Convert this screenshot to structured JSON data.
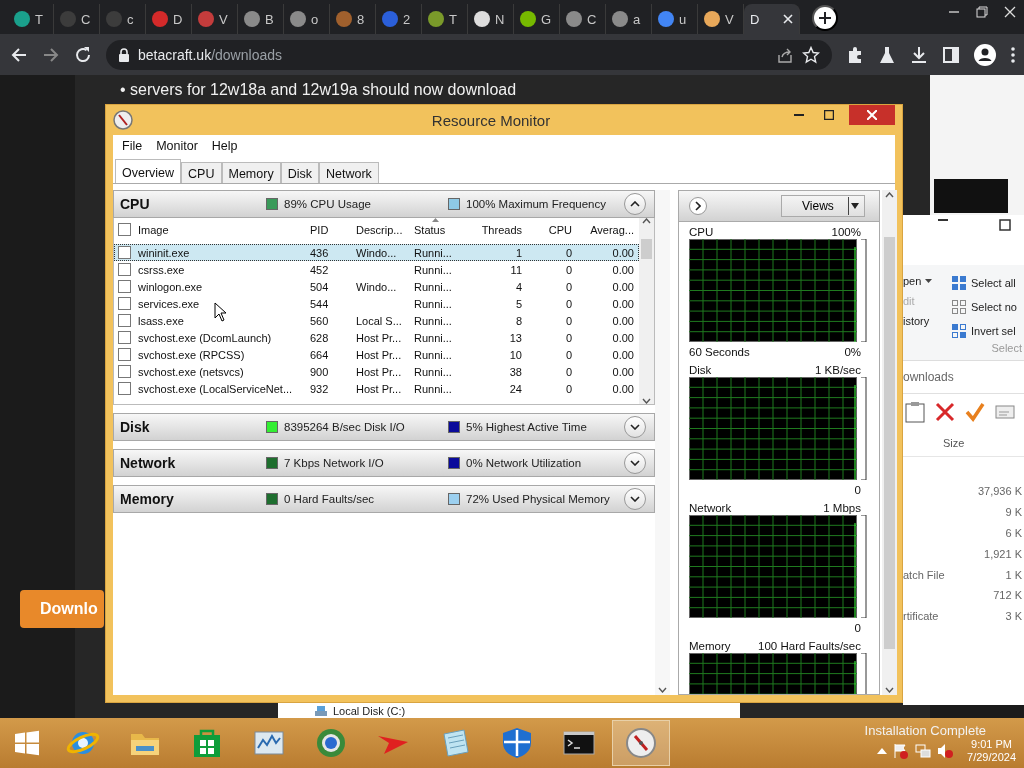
{
  "browser": {
    "tabs": [
      {
        "label": "T",
        "color": "#1aa08c",
        "selected": false
      },
      {
        "label": "C",
        "color": "#3c3c3c",
        "selected": false
      },
      {
        "label": "c",
        "color": "#3c3c3c",
        "selected": false
      },
      {
        "label": "D",
        "color": "#d42a2a",
        "selected": false
      },
      {
        "label": "V",
        "color": "#c43c3c",
        "selected": false
      },
      {
        "label": "B",
        "color": "#8a8a8a",
        "selected": false
      },
      {
        "label": "o",
        "color": "#8a8a8a",
        "selected": false
      },
      {
        "label": "8",
        "color": "#a0602d",
        "selected": false
      },
      {
        "label": "2",
        "color": "#2b5fd9",
        "selected": false
      },
      {
        "label": "T",
        "color": "#7a9a2a",
        "selected": false
      },
      {
        "label": "N",
        "color": "#dddddd",
        "selected": false
      },
      {
        "label": "G",
        "color": "#76b900",
        "selected": false
      },
      {
        "label": "C",
        "color": "#8a8a8a",
        "selected": false
      },
      {
        "label": "a",
        "color": "#8a8a8a",
        "selected": false
      },
      {
        "label": "u",
        "color": "#4285f4",
        "selected": false
      },
      {
        "label": "V",
        "color": "#e8a85a",
        "selected": false
      },
      {
        "label": "D",
        "selected": true
      }
    ],
    "url_host": "betacraft.uk",
    "url_path": "/downloads"
  },
  "web_page": {
    "text": "• servers for 12w18a and 12w19a should now download",
    "button": "Downlo"
  },
  "resource_monitor": {
    "title": "Resource Monitor",
    "menu": [
      "File",
      "Monitor",
      "Help"
    ],
    "tabs": [
      {
        "label": "Overview",
        "selected": true
      },
      {
        "label": "CPU",
        "selected": false
      },
      {
        "label": "Memory",
        "selected": false
      },
      {
        "label": "Disk",
        "selected": false
      },
      {
        "label": "Network",
        "selected": false
      }
    ],
    "sections": [
      {
        "title": "CPU",
        "expanded": true,
        "metrics": [
          {
            "text": "89% CPU Usage",
            "color": "#3a9a5a"
          },
          {
            "text": "100% Maximum Frequency",
            "color": "#8ecae6"
          }
        ],
        "table": {
          "columns": [
            "Image",
            "PID",
            "Descrip...",
            "Status",
            "Threads",
            "CPU",
            "Averag..."
          ],
          "all_checked": false,
          "rows": [
            {
              "image": "wininit.exe",
              "pid": "436",
              "description": "Windo...",
              "status": "Runni...",
              "threads": "1",
              "cpu": "0",
              "average": "0.00",
              "checked": false,
              "selected": true
            },
            {
              "image": "csrss.exe",
              "pid": "452",
              "status": "Runni...",
              "threads": "11",
              "cpu": "0",
              "average": "0.00",
              "checked": false,
              "selected": false
            },
            {
              "image": "winlogon.exe",
              "pid": "504",
              "description": "Windo...",
              "status": "Runni...",
              "threads": "4",
              "cpu": "0",
              "average": "0.00",
              "checked": false,
              "selected": false
            },
            {
              "image": "services.exe",
              "pid": "544",
              "status": "Runni...",
              "threads": "5",
              "cpu": "0",
              "average": "0.00",
              "checked": false,
              "selected": false
            },
            {
              "image": "lsass.exe",
              "pid": "560",
              "description": "Local S...",
              "status": "Runni...",
              "threads": "8",
              "cpu": "0",
              "average": "0.00",
              "checked": false,
              "selected": false
            },
            {
              "image": "svchost.exe (DcomLaunch)",
              "pid": "628",
              "description": "Host Pr...",
              "status": "Runni...",
              "threads": "13",
              "cpu": "0",
              "average": "0.00",
              "checked": false,
              "selected": false
            },
            {
              "image": "svchost.exe (RPCSS)",
              "pid": "664",
              "description": "Host Pr...",
              "status": "Runni...",
              "threads": "10",
              "cpu": "0",
              "average": "0.00",
              "checked": false,
              "selected": false
            },
            {
              "image": "svchost.exe (netsvcs)",
              "pid": "900",
              "description": "Host Pr...",
              "status": "Runni...",
              "threads": "38",
              "cpu": "0",
              "average": "0.00",
              "checked": false,
              "selected": false
            },
            {
              "image": "svchost.exe (LocalServiceNet...",
              "pid": "932",
              "description": "Host Pr...",
              "status": "Runni...",
              "threads": "24",
              "cpu": "0",
              "average": "0.00",
              "checked": false,
              "selected": false
            }
          ]
        }
      },
      {
        "title": "Disk",
        "expanded": false,
        "metrics": [
          {
            "text": "8395264 B/sec Disk I/O",
            "color": "#33ee33"
          },
          {
            "text": "5% Highest Active Time",
            "color": "#0a0a9a"
          }
        ]
      },
      {
        "title": "Network",
        "expanded": false,
        "metrics": [
          {
            "text": "7 Kbps Network I/O",
            "color": "#1e6e2e"
          },
          {
            "text": "0% Network Utilization",
            "color": "#0a0a9b"
          }
        ]
      },
      {
        "title": "Memory",
        "expanded": false,
        "metrics": [
          {
            "text": "0 Hard Faults/sec",
            "color": "#1e6e2f"
          },
          {
            "text": "72% Used Physical Memory",
            "color": "#9cd0f0"
          }
        ]
      }
    ],
    "views_button": "Views",
    "graphs": [
      {
        "title": "CPU",
        "max": "100%",
        "span": "60 Seconds",
        "min": "0%"
      },
      {
        "title": "Disk",
        "max": "1 KB/sec",
        "min": "0"
      },
      {
        "title": "Network",
        "max": "1 Mbps",
        "min": "0"
      },
      {
        "title": "Memory",
        "max": "100 Hard Faults/sec"
      }
    ]
  },
  "explorer": {
    "ribbon": [
      {
        "label": "pen",
        "kind": "dropdown",
        "disabled": false
      },
      {
        "label": "dit",
        "kind": "plain",
        "disabled": true
      },
      {
        "label": "istory",
        "kind": "plain",
        "disabled": false
      }
    ],
    "commands": [
      {
        "label": "Select all",
        "kind": "select-all"
      },
      {
        "label": "Select no",
        "kind": "select-none"
      },
      {
        "label": "Invert sel",
        "kind": "invert"
      }
    ],
    "group": "Select",
    "path": "ownloads",
    "column": "Size",
    "files": [
      {
        "size": "37,936 K"
      },
      {
        "size": "9 K"
      },
      {
        "size": "6 K"
      },
      {
        "size": "1,921 K"
      },
      {
        "type": "atch File",
        "size": "1 K"
      },
      {
        "size": "712 K"
      },
      {
        "type": "rtificate",
        "size": "3 K"
      }
    ]
  },
  "drive_pane": {
    "item": "Local Disk (C:)"
  },
  "taskbar": {
    "apps": [
      {
        "kind": "ie",
        "active": false
      },
      {
        "kind": "explorer",
        "active": false
      },
      {
        "kind": "store",
        "active": false
      },
      {
        "kind": "perfmon",
        "active": false
      },
      {
        "kind": "globe",
        "active": false
      },
      {
        "kind": "arrow",
        "active": false
      },
      {
        "kind": "notepad",
        "active": false
      },
      {
        "kind": "shield",
        "active": false
      },
      {
        "kind": "cmd",
        "active": false
      },
      {
        "kind": "resmon",
        "active": true
      }
    ],
    "notification": "Installation Complete",
    "time": "9:01 PM",
    "date": "7/29/2024"
  }
}
